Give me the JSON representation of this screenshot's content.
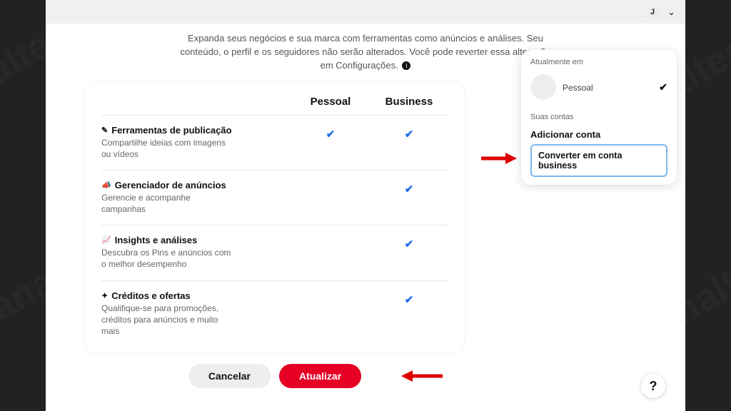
{
  "topbar": {
    "avatar_letter": "J"
  },
  "intro": {
    "line": "Expanda seus negócios e sua marca com ferramentas como anúncios e análises. Seu conteúdo, o perfil e os seguidores não serão alterados. Você pode reverter essa alteração em Configurações."
  },
  "table": {
    "col_personal": "Pessoal",
    "col_business": "Business",
    "rows": [
      {
        "icon": "✎",
        "title": "Ferramentas de publicação",
        "desc": "Compartilhe ideias com imagens ou vídeos",
        "personal": true,
        "business": true
      },
      {
        "icon": "📣",
        "title": "Gerenciador de anúncios",
        "desc": "Gerencie e acompanhe campanhas",
        "personal": false,
        "business": true
      },
      {
        "icon": "📈",
        "title": "Insights e análises",
        "desc": "Descubra os Pins e anúncios com o melhor desempenho",
        "personal": false,
        "business": true
      },
      {
        "icon": "✦",
        "title": "Créditos e ofertas",
        "desc": "Qualifique-se para promoções, créditos para anúncios e muito mais",
        "personal": false,
        "business": true
      }
    ]
  },
  "buttons": {
    "cancel": "Cancelar",
    "update": "Atualizar"
  },
  "panel": {
    "currently_label": "Atualmente em",
    "current_name": "Pessoal",
    "your_accounts_label": "Suas contas",
    "add_account": "Adicionar conta",
    "convert_business": "Converter em conta business"
  },
  "help": "?"
}
